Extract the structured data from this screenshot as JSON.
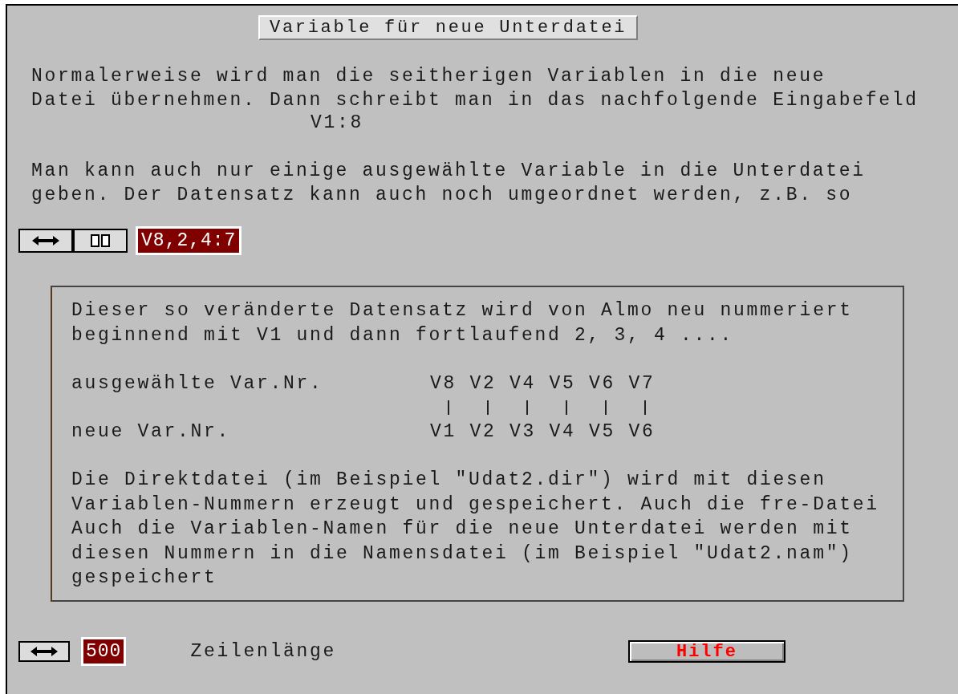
{
  "title": "Variable für neue Unterdatei",
  "intro": "Normalerweise wird man die seitherigen Variablen in die neue\nDatei übernehmen. Dann schreibt man in das nachfolgende Eingabefeld",
  "example": "V1:8",
  "intro2": "Man kann auch nur einige ausgewählte Variable in die Unterdatei\ngeben. Der Datensatz kann auch noch umgeordnet werden, z.B. so",
  "variable_field": {
    "value": "V8,2,4:7"
  },
  "info_box": {
    "text1": "Dieser so veränderte Datensatz wird von Almo neu nummeriert\nbeginnend mit V1 und dann fortlaufend 2, 3, 4 ....",
    "mapping": [
      {
        "label": "ausgewählte Var.Nr.",
        "values": [
          "V8",
          "V2",
          "V4",
          "V5",
          "V6",
          "V7"
        ]
      },
      {
        "label": "neue Var.Nr.",
        "values": [
          "V1",
          "V2",
          "V3",
          "V4",
          "V5",
          "V6"
        ]
      }
    ],
    "text2": "Die Direktdatei (im Beispiel \"Udat2.dir\") wird mit diesen\nVariablen-Nummern erzeugt und gespeichert. Auch die fre-Datei\nAuch die Variablen-Namen für die neue Unterdatei werden mit\ndiesen Nummern in die Namensdatei (im Beispiel \"Udat2.nam\")\ngespeichert"
  },
  "line_length": {
    "value": "500",
    "label": "Zeilenlänge"
  },
  "help_button": "Hilfe"
}
